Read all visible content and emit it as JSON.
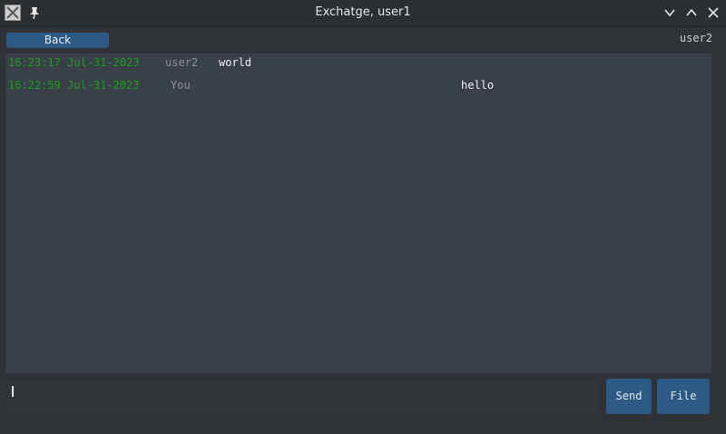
{
  "window": {
    "title": "Exchatge, user1"
  },
  "header": {
    "back_label": "Back",
    "peer_name": "user2"
  },
  "messages": [
    {
      "time": "16:23:17 Jul-31-2023",
      "user": "user2",
      "text": "world"
    },
    {
      "time": "16:22:59 Jul-31-2023",
      "user": "You",
      "text": "hello"
    }
  ],
  "composer": {
    "value": "",
    "send_label": "Send",
    "file_label": "File"
  },
  "icons": {
    "app": "app-icon",
    "pin": "pin-icon",
    "minimize": "chevron-down-icon",
    "maximize": "chevron-up-icon",
    "close": "close-icon"
  },
  "colors": {
    "accent": "#2d5a84",
    "timestamp": "#18a01c",
    "background": "#2f3338",
    "chat_background": "#394047"
  }
}
